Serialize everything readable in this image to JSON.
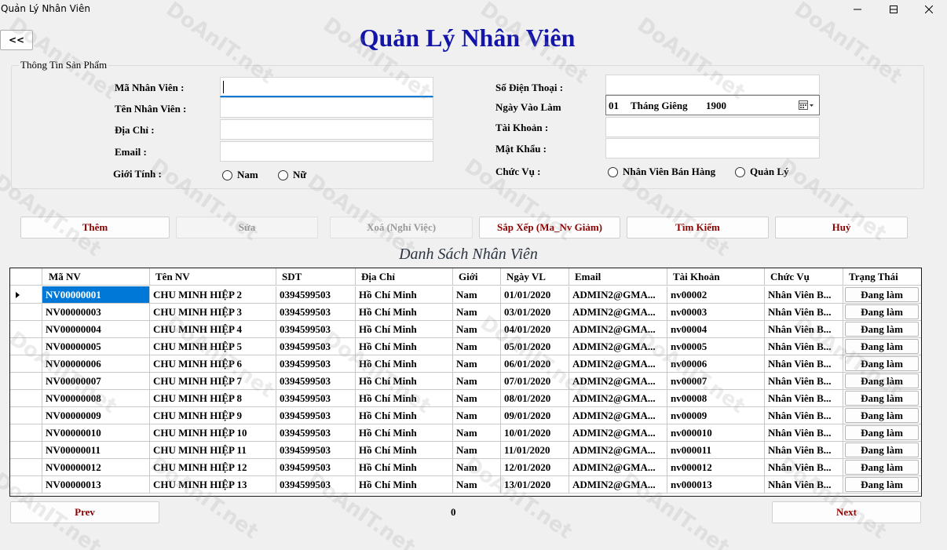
{
  "window": {
    "title": "Quản Lý Nhân Viên"
  },
  "back_label": "<<",
  "app_title": "Quản Lý Nhân Viên",
  "group_title": "Thông Tin Sản Phẩm",
  "form": {
    "ma_nv_label": "Mã Nhân Viên :",
    "ten_nv_label": "Tên Nhân Viên :",
    "dia_chi_label": "Địa Chỉ :",
    "email_label": "Email :",
    "gioi_tinh_label": "Giới Tính :",
    "gender_nam": "Nam",
    "gender_nu": "Nữ",
    "sdt_label": "Số Điện Thoại :",
    "ngay_vao_lam_label": "Ngày Vào Làm",
    "date_day": "01",
    "date_month": "Tháng Giêng",
    "date_year": "1900",
    "tai_khoan_label": "Tài Khoản :",
    "mat_khau_label": "Mật Khẩu :",
    "chuc_vu_label": "Chức Vụ :",
    "role_ban_hang": "Nhân Viên Bán Hàng",
    "role_quan_ly": "Quản Lý",
    "ma_nv_value": "",
    "ten_nv_value": "",
    "dia_chi_value": "",
    "email_value": "",
    "sdt_value": "",
    "tai_khoan_value": "",
    "mat_khau_value": ""
  },
  "actions": {
    "them": "Thêm",
    "sua": "Sửa",
    "xoa": "Xoá (Nghỉ Việc)",
    "sap_xep": "Sắp Xếp (Ma_Nv Giảm)",
    "tim_kiem": "Tìm Kiếm",
    "huy": "Huỷ"
  },
  "list_title": "Danh Sách Nhân Viên",
  "table": {
    "columns": [
      "Mã NV",
      "Tên NV",
      "SDT",
      "Địa Chỉ",
      "Giới",
      "Ngày VL",
      "Email",
      "Tài Khoản",
      "Chức Vụ",
      "Trạng Thái"
    ],
    "rows": [
      [
        "NV00000001",
        "CHU MINH HIỆP 2",
        "0394599503",
        "Hồ Chí Minh",
        "Nam",
        "01/01/2020",
        "ADMIN2@GMA...",
        "nv00002",
        "Nhân Viên B...",
        "Đang làm"
      ],
      [
        "NV00000003",
        "CHU MINH HIỆP 3",
        "0394599503",
        "Hồ Chí Minh",
        "Nam",
        "03/01/2020",
        "ADMIN2@GMA...",
        "nv00003",
        "Nhân Viên B...",
        "Đang làm"
      ],
      [
        "NV00000004",
        "CHU MINH HIỆP 4",
        "0394599503",
        "Hồ Chí Minh",
        "Nam",
        "04/01/2020",
        "ADMIN2@GMA...",
        "nv00004",
        "Nhân Viên B...",
        "Đang làm"
      ],
      [
        "NV00000005",
        "CHU MINH HIỆP 5",
        "0394599503",
        "Hồ Chí Minh",
        "Nam",
        "05/01/2020",
        "ADMIN2@GMA...",
        "nv00005",
        "Nhân Viên B...",
        "Đang làm"
      ],
      [
        "NV00000006",
        "CHU MINH HIỆP 6",
        "0394599503",
        "Hồ Chí Minh",
        "Nam",
        "06/01/2020",
        "ADMIN2@GMA...",
        "nv00006",
        "Nhân Viên B...",
        "Đang làm"
      ],
      [
        "NV00000007",
        "CHU MINH HIỆP 7",
        "0394599503",
        "Hồ Chí Minh",
        "Nam",
        "07/01/2020",
        "ADMIN2@GMA...",
        "nv00007",
        "Nhân Viên B...",
        "Đang làm"
      ],
      [
        "NV00000008",
        "CHU MINH HIỆP 8",
        "0394599503",
        "Hồ Chí Minh",
        "Nam",
        "08/01/2020",
        "ADMIN2@GMA...",
        "nv00008",
        "Nhân Viên B...",
        "Đang làm"
      ],
      [
        "NV00000009",
        "CHU MINH HIỆP 9",
        "0394599503",
        "Hồ Chí Minh",
        "Nam",
        "09/01/2020",
        "ADMIN2@GMA...",
        "nv00009",
        "Nhân Viên B...",
        "Đang làm"
      ],
      [
        "NV00000010",
        "CHU MINH HIỆP 10",
        "0394599503",
        "Hồ Chí Minh",
        "Nam",
        "10/01/2020",
        "ADMIN2@GMA...",
        "nv000010",
        "Nhân Viên B...",
        "Đang làm"
      ],
      [
        "NV00000011",
        "CHU MINH HIỆP 11",
        "0394599503",
        "Hồ Chí Minh",
        "Nam",
        "11/01/2020",
        "ADMIN2@GMA...",
        "nv000011",
        "Nhân Viên B...",
        "Đang làm"
      ],
      [
        "NV00000012",
        "CHU MINH HIỆP 12",
        "0394599503",
        "Hồ Chí Minh",
        "Nam",
        "12/01/2020",
        "ADMIN2@GMA...",
        "nv000012",
        "Nhân Viên B...",
        "Đang làm"
      ],
      [
        "NV00000013",
        "CHU MINH HIỆP 13",
        "0394599503",
        "Hồ Chí Minh",
        "Nam",
        "13/01/2020",
        "ADMIN2@GMA...",
        "nv000013",
        "Nhân Viên B...",
        "Đang làm"
      ]
    ]
  },
  "pagination": {
    "prev": "Prev",
    "next": "Next",
    "page": "0"
  },
  "watermark_text": "DoAnIT.net",
  "icons": {
    "minimize": "minimize-icon",
    "maximize": "maximize-icon",
    "close": "close-icon",
    "calendar": "calendar-icon",
    "row_arrow": "current-row-arrow-icon"
  },
  "colors": {
    "title": "#1414a8",
    "action_text": "#8b0000",
    "selection": "#0078d7",
    "focus": "#0078d7"
  }
}
